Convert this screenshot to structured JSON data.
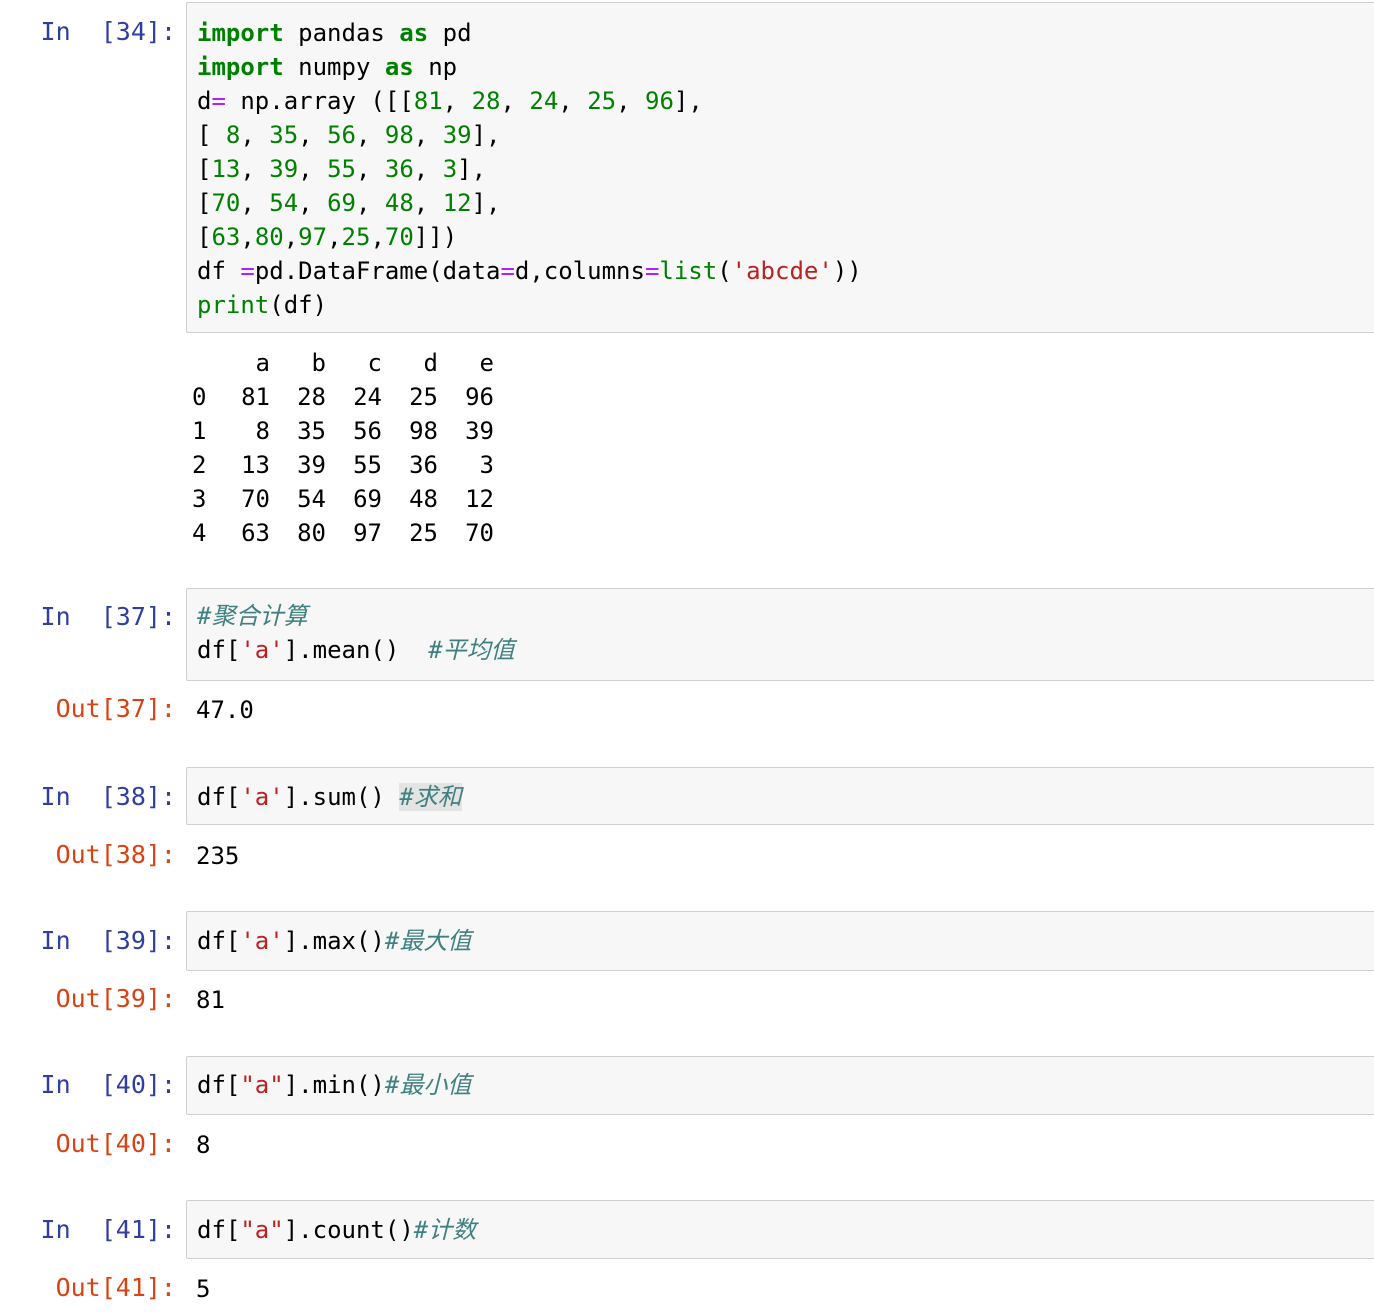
{
  "cells": [
    {
      "in_prompt": "In  [34]:",
      "code_lines": [
        [
          "import",
          " pandas ",
          "as",
          " pd"
        ],
        [
          "import",
          " numpy ",
          "as",
          " np"
        ],
        [
          "d",
          "=",
          " np.array ([[",
          "81",
          ", ",
          "28",
          ", ",
          "24",
          ", ",
          "25",
          ", ",
          "96",
          "],"
        ],
        [
          "[ ",
          "8",
          ", ",
          "35",
          ", ",
          "56",
          ", ",
          "98",
          ", ",
          "39",
          "],"
        ],
        [
          "[",
          "13",
          ", ",
          "39",
          ", ",
          "55",
          ", ",
          "36",
          ", ",
          "3",
          "],"
        ],
        [
          "[",
          "70",
          ", ",
          "54",
          ", ",
          "69",
          ", ",
          "48",
          ", ",
          "12",
          "],"
        ],
        [
          "[",
          "63",
          ",",
          "80",
          ",",
          "97",
          ",",
          "25",
          ",",
          "70",
          "]])"
        ],
        [
          "df ",
          "=",
          "pd.DataFrame(data",
          "=",
          "d,columns",
          "=",
          "list",
          "(",
          "'abcde'",
          "))"
        ],
        [
          "print",
          "(df)"
        ]
      ],
      "output_table": {
        "columns": [
          "a",
          "b",
          "c",
          "d",
          "e"
        ],
        "rows": [
          {
            "index": "0",
            "values": [
              "81",
              "28",
              "24",
              "25",
              "96"
            ]
          },
          {
            "index": "1",
            "values": [
              "8",
              "35",
              "56",
              "98",
              "39"
            ]
          },
          {
            "index": "2",
            "values": [
              "13",
              "39",
              "55",
              "36",
              "3"
            ]
          },
          {
            "index": "3",
            "values": [
              "70",
              "54",
              "69",
              "48",
              "12"
            ]
          },
          {
            "index": "4",
            "values": [
              "63",
              "80",
              "97",
              "25",
              "70"
            ]
          }
        ]
      }
    },
    {
      "in_prompt": "In  [37]:",
      "code_lines": [
        [
          "#聚合计算"
        ],
        [
          "df[",
          "'a'",
          "].mean()  ",
          "#平均值"
        ]
      ],
      "out_prompt": "Out[37]:",
      "output": "47.0"
    },
    {
      "in_prompt": "In  [38]:",
      "code_lines": [
        [
          "df[",
          "'a'",
          "].sum() ",
          "#求和"
        ]
      ],
      "out_prompt": "Out[38]:",
      "output": "235"
    },
    {
      "in_prompt": "In  [39]:",
      "code_lines": [
        [
          "df[",
          "'a'",
          "].max()",
          "#最大值"
        ]
      ],
      "out_prompt": "Out[39]:",
      "output": "81"
    },
    {
      "in_prompt": "In  [40]:",
      "code_lines": [
        [
          "df[",
          "\"a\"",
          "].min()",
          "#最小值"
        ]
      ],
      "out_prompt": "Out[40]:",
      "output": "8"
    },
    {
      "in_prompt": "In  [41]:",
      "code_lines": [
        [
          "df[",
          "\"a\"",
          "].count()",
          "#计数"
        ]
      ],
      "out_prompt": "Out[41]:",
      "output": "5"
    }
  ],
  "colors": {
    "in_prompt": "#303f9f",
    "out_prompt": "#d84315",
    "keyword": "#008000",
    "string": "#ba2121",
    "comment": "#408080",
    "operator": "#aa22ff",
    "cell_background": "#f7f7f7",
    "cell_border": "#cfcfcf"
  }
}
